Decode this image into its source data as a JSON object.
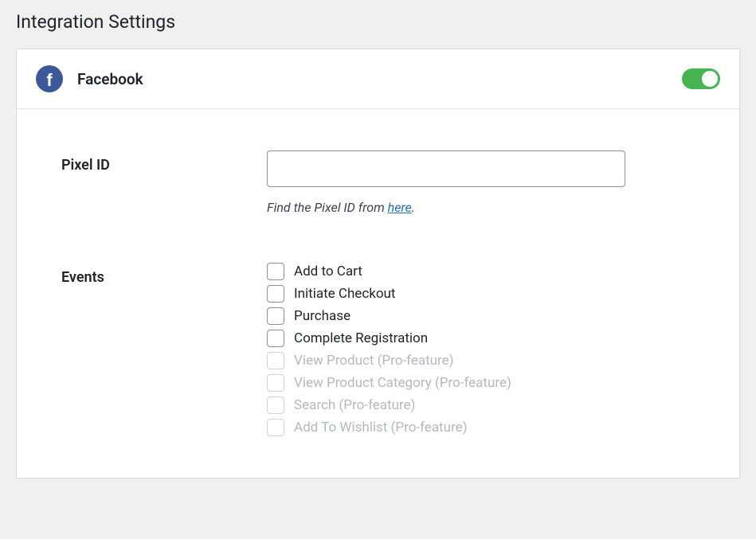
{
  "page_title": "Integration Settings",
  "provider": {
    "name": "Facebook",
    "enabled": true
  },
  "pixel_id": {
    "label": "Pixel ID",
    "value": "",
    "help_prefix": "Find the Pixel ID from ",
    "help_link_text": "here",
    "help_suffix": "."
  },
  "events": {
    "label": "Events",
    "items": [
      {
        "label": "Add to Cart",
        "disabled": false
      },
      {
        "label": "Initiate Checkout",
        "disabled": false
      },
      {
        "label": "Purchase",
        "disabled": false
      },
      {
        "label": "Complete Registration",
        "disabled": false
      },
      {
        "label": "View Product (Pro-feature)",
        "disabled": true
      },
      {
        "label": "View Product Category (Pro-feature)",
        "disabled": true
      },
      {
        "label": "Search (Pro-feature)",
        "disabled": true
      },
      {
        "label": "Add To Wishlist (Pro-feature)",
        "disabled": true
      }
    ]
  }
}
